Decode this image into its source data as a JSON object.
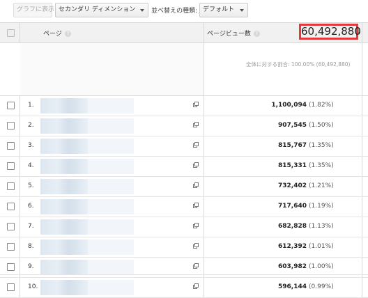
{
  "toolbar": {
    "graph_button": "グラフに表示",
    "secondary_dimension": "セカンダリ ディメンション",
    "sort_label": "並べ替えの種類:",
    "sort_value": "デフォルト"
  },
  "table": {
    "col_page": "ページ",
    "col_pageviews": "ページビュー数",
    "sort_indicator": "↓"
  },
  "totals": {
    "value": "60,492,880",
    "subtext_prefix": "全体に対する割合:",
    "subtext_suffix": "100.00% (60,492,880)"
  },
  "rows": [
    {
      "index": "1.",
      "value": "1,100,094",
      "percent": "(1.82%)"
    },
    {
      "index": "2.",
      "value": "907,545",
      "percent": "(1.50%)"
    },
    {
      "index": "3.",
      "value": "815,767",
      "percent": "(1.35%)"
    },
    {
      "index": "4.",
      "value": "815,331",
      "percent": "(1.35%)"
    },
    {
      "index": "5.",
      "value": "732,402",
      "percent": "(1.21%)"
    },
    {
      "index": "6.",
      "value": "717,640",
      "percent": "(1.19%)"
    },
    {
      "index": "7.",
      "value": "682,828",
      "percent": "(1.13%)"
    },
    {
      "index": "8.",
      "value": "612,392",
      "percent": "(1.01%)"
    },
    {
      "index": "9.",
      "value": "603,982",
      "percent": "(1.00%)"
    },
    {
      "index": "10.",
      "value": "596,144",
      "percent": "(0.99%)"
    }
  ],
  "icons": {
    "open_link": "external-link-icon",
    "help": "help-icon",
    "dropdown": "chevron-down-icon"
  },
  "colors": {
    "highlight": "#e03a3e"
  }
}
